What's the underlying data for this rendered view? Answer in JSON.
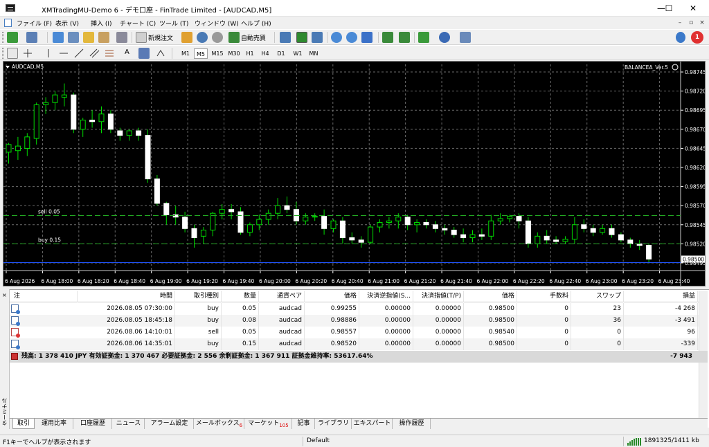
{
  "window": {
    "title": "XMTradingMU-Demo 6 - デモ口座 - FinTrade Limited - [AUDCAD,M5]",
    "minimize": "—",
    "maximize": "☐",
    "close": "✕"
  },
  "menu": {
    "items": [
      "ファイル (F)",
      "表示 (V)",
      "挿入 (I)",
      "チャート (C)",
      "ツール (T)",
      "ウィンドウ (W)",
      "ヘルプ (H)"
    ],
    "mdi_min": "–",
    "mdi_restore": "▫",
    "mdi_close": "×",
    "notification_count": "1"
  },
  "toolbar": {
    "new_order": "新規注文",
    "auto_trading": "自動売買",
    "text_tool": "A",
    "timeframes": [
      "M1",
      "M5",
      "M15",
      "M30",
      "H1",
      "H4",
      "D1",
      "W1",
      "MN"
    ],
    "selected_timeframe": "M5"
  },
  "chart": {
    "symbol_label": "AUDCAD,M5",
    "ea_label": "BALANCEA_Ver.5",
    "line_labels": [
      {
        "text": "sell 0.05",
        "price": 0.98557
      },
      {
        "text": "buy 0.15",
        "price": 0.9852
      }
    ],
    "current_price": "0.98500",
    "colors": {
      "bg": "#000000",
      "grid": "#6a6a6a",
      "up": "#00dd00",
      "down": "#ffffff",
      "level": "#22aa22",
      "ask": "#2255ff"
    }
  },
  "chart_data": {
    "type": "candlestick",
    "symbol": "AUDCAD",
    "timeframe": "M5",
    "ylim": [
      0.98485,
      0.98755
    ],
    "y_ticks": [
      "0.98745",
      "0.98720",
      "0.98695",
      "0.98670",
      "0.98645",
      "0.98620",
      "0.98595",
      "0.98570",
      "0.98545",
      "0.98520",
      "0.98495"
    ],
    "x_ticks": [
      "6 Aug 2026",
      "6 Aug 18:00",
      "6 Aug 18:20",
      "6 Aug 18:40",
      "6 Aug 19:00",
      "6 Aug 19:20",
      "6 Aug 19:40",
      "6 Aug 20:00",
      "6 Aug 20:20",
      "6 Aug 20:40",
      "6 Aug 21:00",
      "6 Aug 21:20",
      "6 Aug 21:40",
      "6 Aug 22:00",
      "6 Aug 22:20",
      "6 Aug 22:40",
      "6 Aug 23:00",
      "6 Aug 23:20",
      "6 Aug 23:40"
    ],
    "grid": true,
    "levels": [
      {
        "name": "sell 0.05",
        "price": 0.98557
      },
      {
        "name": "buy 0.15",
        "price": 0.9852
      }
    ],
    "current_price": 0.985,
    "candles": [
      {
        "o": 0.9864,
        "h": 0.98652,
        "l": 0.98625,
        "c": 0.9865
      },
      {
        "o": 0.98642,
        "h": 0.9866,
        "l": 0.9863,
        "c": 0.98648
      },
      {
        "o": 0.98645,
        "h": 0.98665,
        "l": 0.98635,
        "c": 0.9866
      },
      {
        "o": 0.98658,
        "h": 0.98705,
        "l": 0.9865,
        "c": 0.98702
      },
      {
        "o": 0.98702,
        "h": 0.98712,
        "l": 0.9869,
        "c": 0.98705
      },
      {
        "o": 0.98705,
        "h": 0.9872,
        "l": 0.98695,
        "c": 0.98715
      },
      {
        "o": 0.98712,
        "h": 0.9873,
        "l": 0.987,
        "c": 0.98715
      },
      {
        "o": 0.98715,
        "h": 0.98718,
        "l": 0.98665,
        "c": 0.9867
      },
      {
        "o": 0.9867,
        "h": 0.98685,
        "l": 0.9866,
        "c": 0.98682
      },
      {
        "o": 0.98682,
        "h": 0.98695,
        "l": 0.98672,
        "c": 0.9868
      },
      {
        "o": 0.9868,
        "h": 0.987,
        "l": 0.98665,
        "c": 0.9869
      },
      {
        "o": 0.9869,
        "h": 0.98695,
        "l": 0.98665,
        "c": 0.9867
      },
      {
        "o": 0.98668,
        "h": 0.98672,
        "l": 0.98655,
        "c": 0.98662
      },
      {
        "o": 0.98662,
        "h": 0.9867,
        "l": 0.98655,
        "c": 0.98668
      },
      {
        "o": 0.98668,
        "h": 0.98672,
        "l": 0.98655,
        "c": 0.98662
      },
      {
        "o": 0.98662,
        "h": 0.9867,
        "l": 0.986,
        "c": 0.98605
      },
      {
        "o": 0.98605,
        "h": 0.9861,
        "l": 0.9857,
        "c": 0.98573
      },
      {
        "o": 0.98573,
        "h": 0.98575,
        "l": 0.98545,
        "c": 0.98558
      },
      {
        "o": 0.98558,
        "h": 0.9857,
        "l": 0.98545,
        "c": 0.98555
      },
      {
        "o": 0.98555,
        "h": 0.98562,
        "l": 0.98535,
        "c": 0.9854
      },
      {
        "o": 0.9854,
        "h": 0.98545,
        "l": 0.98515,
        "c": 0.98528
      },
      {
        "o": 0.9853,
        "h": 0.98542,
        "l": 0.9852,
        "c": 0.98538
      },
      {
        "o": 0.98538,
        "h": 0.98562,
        "l": 0.9853,
        "c": 0.9856
      },
      {
        "o": 0.9856,
        "h": 0.98572,
        "l": 0.98552,
        "c": 0.98565
      },
      {
        "o": 0.98565,
        "h": 0.98572,
        "l": 0.98552,
        "c": 0.98562
      },
      {
        "o": 0.98562,
        "h": 0.98568,
        "l": 0.98532,
        "c": 0.98535
      },
      {
        "o": 0.98535,
        "h": 0.98548,
        "l": 0.9853,
        "c": 0.98545
      },
      {
        "o": 0.98545,
        "h": 0.98558,
        "l": 0.98538,
        "c": 0.98552
      },
      {
        "o": 0.98552,
        "h": 0.98565,
        "l": 0.98545,
        "c": 0.9856
      },
      {
        "o": 0.9856,
        "h": 0.9858,
        "l": 0.98552,
        "c": 0.9857
      },
      {
        "o": 0.9857,
        "h": 0.98582,
        "l": 0.9856,
        "c": 0.98565
      },
      {
        "o": 0.98565,
        "h": 0.98575,
        "l": 0.98545,
        "c": 0.9855
      },
      {
        "o": 0.9855,
        "h": 0.9856,
        "l": 0.98545,
        "c": 0.98555
      },
      {
        "o": 0.98555,
        "h": 0.9856,
        "l": 0.9855,
        "c": 0.98556
      },
      {
        "o": 0.98556,
        "h": 0.98565,
        "l": 0.98532,
        "c": 0.9854
      },
      {
        "o": 0.9854,
        "h": 0.98552,
        "l": 0.98535,
        "c": 0.9855
      },
      {
        "o": 0.9855,
        "h": 0.98555,
        "l": 0.9852,
        "c": 0.98528
      },
      {
        "o": 0.98528,
        "h": 0.98535,
        "l": 0.9852,
        "c": 0.98525
      },
      {
        "o": 0.98525,
        "h": 0.9853,
        "l": 0.98515,
        "c": 0.98522
      },
      {
        "o": 0.98522,
        "h": 0.98545,
        "l": 0.9852,
        "c": 0.98542
      },
      {
        "o": 0.98542,
        "h": 0.98552,
        "l": 0.98535,
        "c": 0.98548
      },
      {
        "o": 0.98548,
        "h": 0.98555,
        "l": 0.9854,
        "c": 0.9855
      },
      {
        "o": 0.9855,
        "h": 0.9856,
        "l": 0.9854,
        "c": 0.98555
      },
      {
        "o": 0.98555,
        "h": 0.98558,
        "l": 0.98538,
        "c": 0.98545
      },
      {
        "o": 0.98545,
        "h": 0.98552,
        "l": 0.98535,
        "c": 0.98548
      },
      {
        "o": 0.98548,
        "h": 0.98552,
        "l": 0.9854,
        "c": 0.98545
      },
      {
        "o": 0.98545,
        "h": 0.9855,
        "l": 0.98535,
        "c": 0.9854
      },
      {
        "o": 0.9854,
        "h": 0.98545,
        "l": 0.98532,
        "c": 0.98538
      },
      {
        "o": 0.98538,
        "h": 0.98542,
        "l": 0.98528,
        "c": 0.98532
      },
      {
        "o": 0.98532,
        "h": 0.9854,
        "l": 0.98522,
        "c": 0.98528
      },
      {
        "o": 0.98528,
        "h": 0.98538,
        "l": 0.98522,
        "c": 0.98532
      },
      {
        "o": 0.98532,
        "h": 0.9854,
        "l": 0.98525,
        "c": 0.9853
      },
      {
        "o": 0.9853,
        "h": 0.98558,
        "l": 0.98525,
        "c": 0.9855
      },
      {
        "o": 0.9855,
        "h": 0.9856,
        "l": 0.98545,
        "c": 0.98553
      },
      {
        "o": 0.98553,
        "h": 0.98558,
        "l": 0.98548,
        "c": 0.98556
      },
      {
        "o": 0.98556,
        "h": 0.9856,
        "l": 0.9854,
        "c": 0.9855
      },
      {
        "o": 0.9855,
        "h": 0.98555,
        "l": 0.98515,
        "c": 0.9852
      },
      {
        "o": 0.9852,
        "h": 0.98535,
        "l": 0.98515,
        "c": 0.9853
      },
      {
        "o": 0.9853,
        "h": 0.98538,
        "l": 0.9852,
        "c": 0.98525
      },
      {
        "o": 0.98525,
        "h": 0.9853,
        "l": 0.9852,
        "c": 0.98523
      },
      {
        "o": 0.98523,
        "h": 0.9853,
        "l": 0.9852,
        "c": 0.98526
      },
      {
        "o": 0.98526,
        "h": 0.98555,
        "l": 0.9852,
        "c": 0.98545
      },
      {
        "o": 0.98545,
        "h": 0.98552,
        "l": 0.98535,
        "c": 0.9854
      },
      {
        "o": 0.9854,
        "h": 0.98545,
        "l": 0.9853,
        "c": 0.98535
      },
      {
        "o": 0.98535,
        "h": 0.98545,
        "l": 0.98532,
        "c": 0.9854
      },
      {
        "o": 0.9854,
        "h": 0.98545,
        "l": 0.98528,
        "c": 0.98532
      },
      {
        "o": 0.98532,
        "h": 0.98535,
        "l": 0.98522,
        "c": 0.98525
      },
      {
        "o": 0.98525,
        "h": 0.98528,
        "l": 0.98515,
        "c": 0.9852
      },
      {
        "o": 0.9852,
        "h": 0.98525,
        "l": 0.98512,
        "c": 0.98518
      },
      {
        "o": 0.98518,
        "h": 0.9852,
        "l": 0.98495,
        "c": 0.985
      }
    ]
  },
  "terminal": {
    "side_close": "×",
    "side_label": "ターミナル",
    "headers": [
      "注",
      "時間",
      "取引種別",
      "数量",
      "通貨ペア",
      "価格",
      "決済逆指値(S...",
      "決済指値(T/P)",
      "価格",
      "手数料",
      "スワップ",
      "損益"
    ],
    "rows": [
      {
        "type": "buy",
        "cells": [
          "2026.08.05 07:30:00",
          "buy",
          "0.05",
          "audcad",
          "0.99255",
          "0.00000",
          "0.00000",
          "0.98500",
          "0",
          "23",
          "-4 268"
        ]
      },
      {
        "type": "buy",
        "cells": [
          "2026.08.05 18:45:18",
          "buy",
          "0.08",
          "audcad",
          "0.98886",
          "0.00000",
          "0.00000",
          "0.98500",
          "0",
          "36",
          "-3 491"
        ]
      },
      {
        "type": "sell",
        "cells": [
          "2026.08.06 14:10:01",
          "sell",
          "0.05",
          "audcad",
          "0.98557",
          "0.00000",
          "0.00000",
          "0.98540",
          "0",
          "0",
          "96"
        ]
      },
      {
        "type": "buy",
        "cells": [
          "2026.08.06 14:35:01",
          "buy",
          "0.15",
          "audcad",
          "0.98520",
          "0.00000",
          "0.00000",
          "0.98500",
          "0",
          "0",
          "-339"
        ]
      }
    ],
    "summary": {
      "text": "残高: 1 378 410 JPY  有効証拠金: 1 370 467  必要証拠金: 2 556  余剰証拠金: 1 367 911  証拠金維持率: 53617.64%",
      "profit": "-7 943"
    },
    "tabs": [
      {
        "label": "取引",
        "badge": ""
      },
      {
        "label": "運用比率",
        "badge": ""
      },
      {
        "label": "口座履歴",
        "badge": ""
      },
      {
        "label": "ニュース",
        "badge": ""
      },
      {
        "label": "アラーム設定",
        "badge": ""
      },
      {
        "label": "メールボックス",
        "badge": "6"
      },
      {
        "label": "マーケット",
        "badge": "105"
      },
      {
        "label": "記事",
        "badge": ""
      },
      {
        "label": "ライブラリ",
        "badge": ""
      },
      {
        "label": "エキスパート",
        "badge": ""
      },
      {
        "label": "操作履歴",
        "badge": ""
      }
    ]
  },
  "status": {
    "help": "F1キーでヘルプが表示されます",
    "profile": "Default",
    "traffic": "1891325/1411 kb"
  }
}
